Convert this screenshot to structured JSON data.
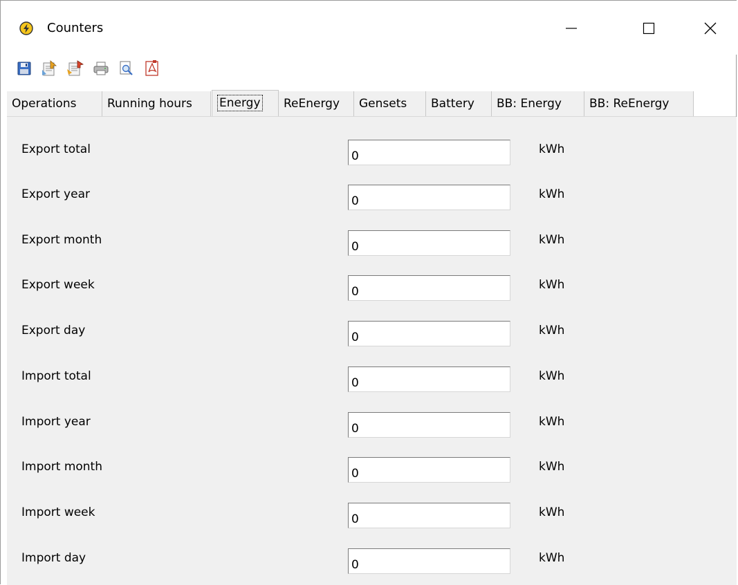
{
  "window": {
    "title": "Counters",
    "accent_color": "#f5c51c"
  },
  "toolbar": {
    "buttons": [
      {
        "name": "save-icon"
      },
      {
        "name": "import-icon"
      },
      {
        "name": "export-icon"
      },
      {
        "name": "print-icon"
      },
      {
        "name": "print-preview-icon"
      },
      {
        "name": "pdf-export-icon"
      }
    ]
  },
  "tabs": [
    {
      "label": "Operations"
    },
    {
      "label": "Running hours"
    },
    {
      "label": "Energy",
      "active": true
    },
    {
      "label": "ReEnergy"
    },
    {
      "label": "Gensets"
    },
    {
      "label": "Battery"
    },
    {
      "label": "BB: Energy"
    },
    {
      "label": "BB: ReEnergy"
    }
  ],
  "rows": [
    {
      "label": "Export total",
      "value": "0",
      "unit": "kWh"
    },
    {
      "label": "Export year",
      "value": "0",
      "unit": "kWh"
    },
    {
      "label": "Export month",
      "value": "0",
      "unit": "kWh"
    },
    {
      "label": "Export week",
      "value": "0",
      "unit": "kWh"
    },
    {
      "label": "Export day",
      "value": "0",
      "unit": "kWh"
    },
    {
      "label": "Import total",
      "value": "0",
      "unit": "kWh"
    },
    {
      "label": "Import year",
      "value": "0",
      "unit": "kWh"
    },
    {
      "label": "Import month",
      "value": "0",
      "unit": "kWh"
    },
    {
      "label": "Import week",
      "value": "0",
      "unit": "kWh"
    },
    {
      "label": "Import day",
      "value": "0",
      "unit": "kWh"
    }
  ]
}
